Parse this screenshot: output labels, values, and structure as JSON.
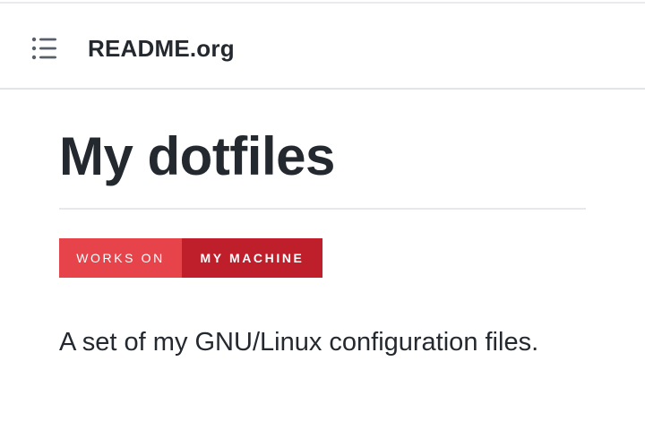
{
  "header": {
    "toc_icon": "list-icon",
    "file_name": "README.org"
  },
  "document": {
    "title": "My dotfiles",
    "badge": {
      "left_text": "WORKS ON",
      "right_text": "MY MACHINE",
      "left_color": "#e7434b",
      "right_color": "#bf1f2b"
    },
    "description": "A set of my GNU/Linux configuration files."
  }
}
